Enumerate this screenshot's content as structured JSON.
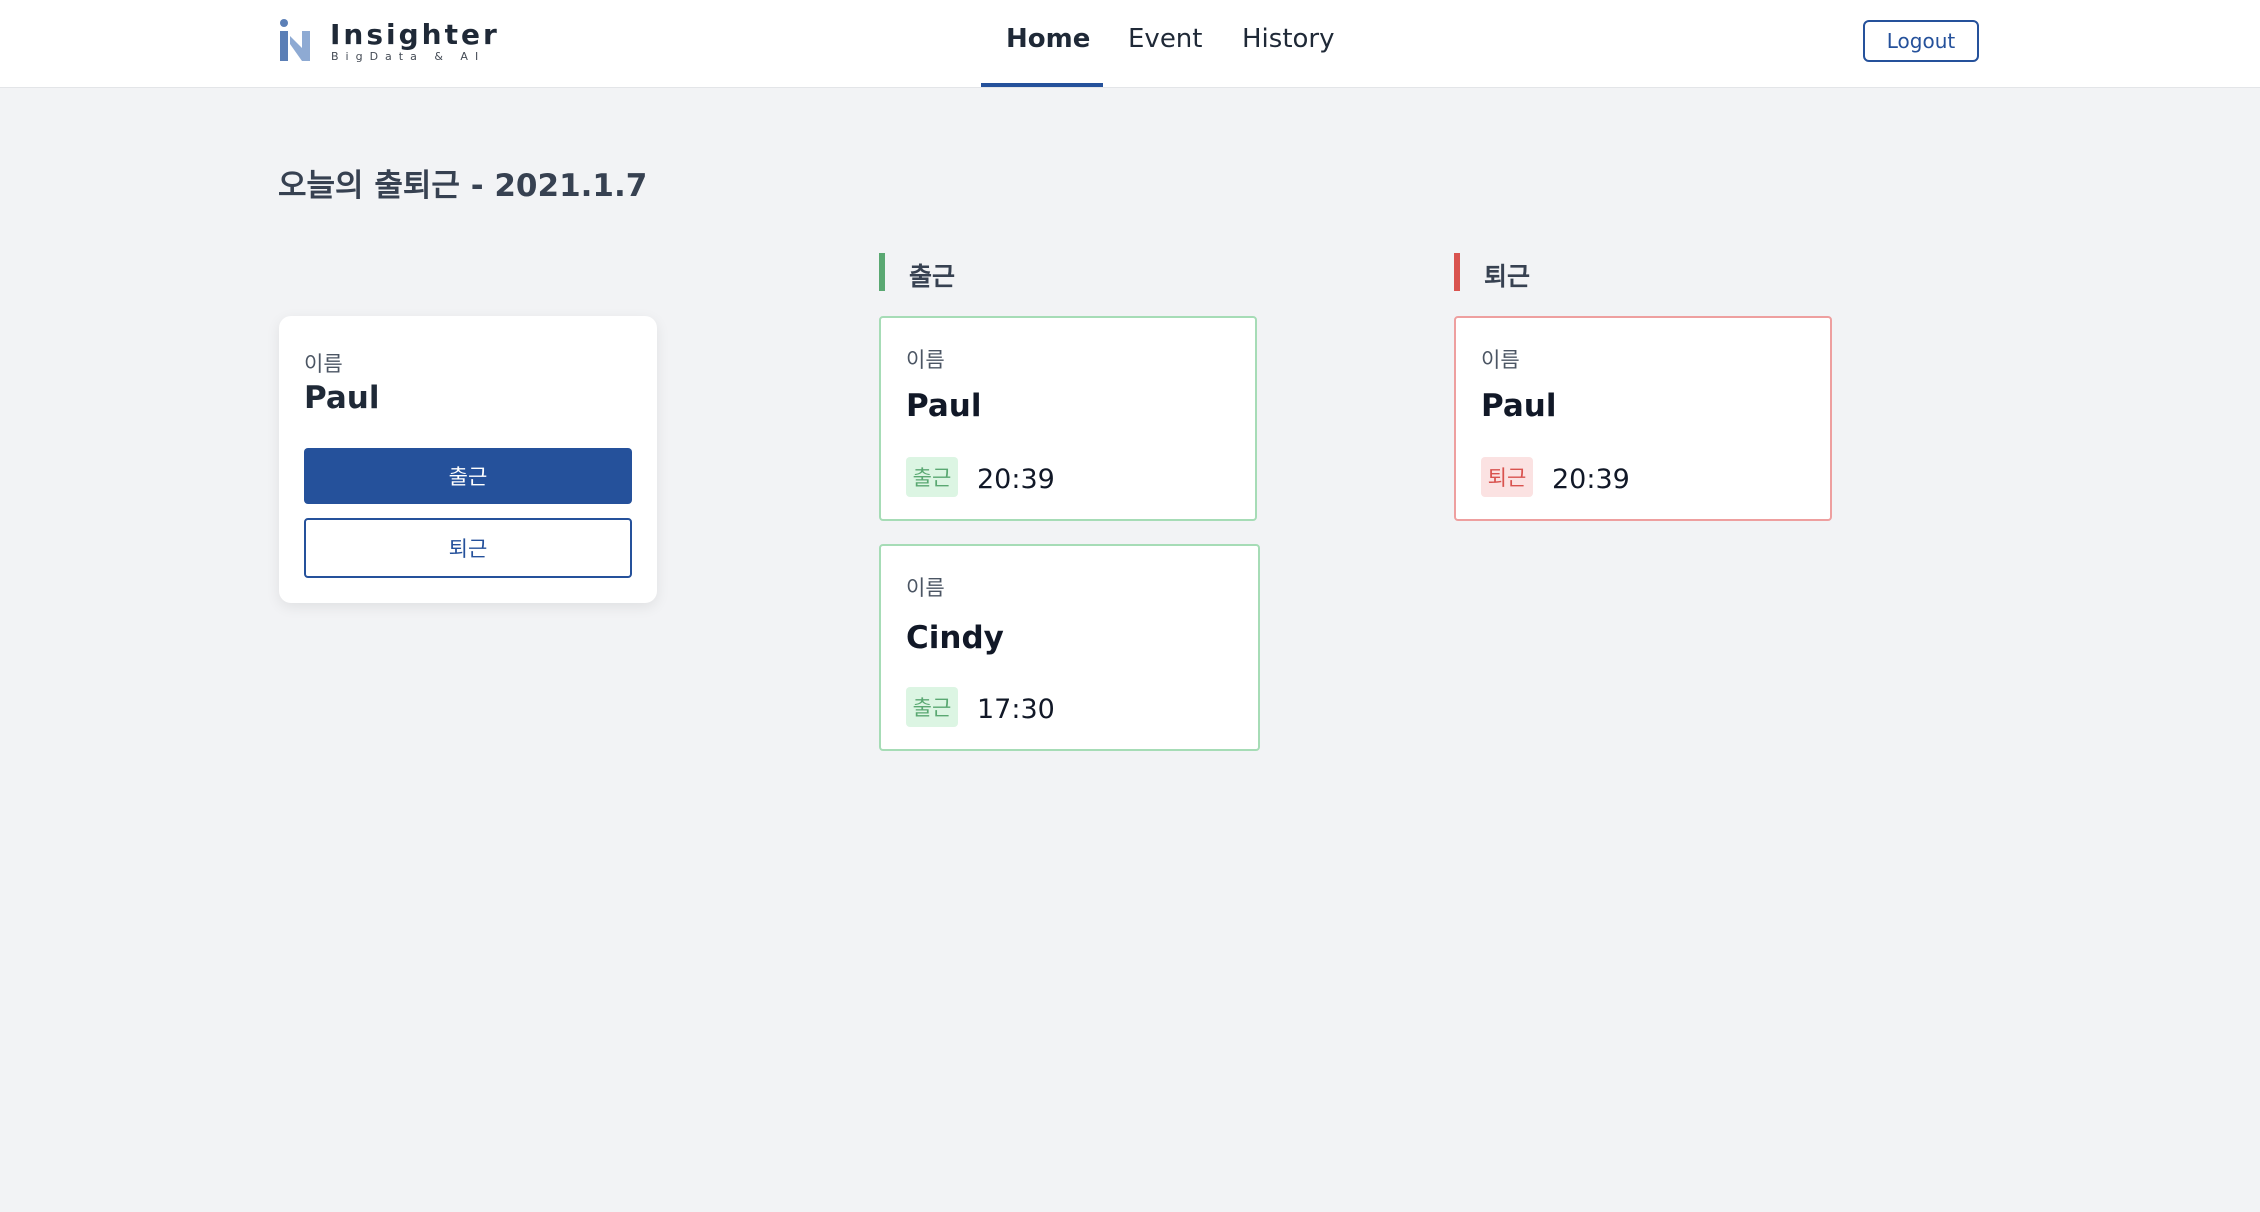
{
  "app": {
    "name": "Insighter",
    "tagline": "BigData & AI"
  },
  "nav": {
    "items": [
      "Home",
      "Event",
      "History"
    ],
    "active": "Home"
  },
  "header": {
    "logout_label": "Logout"
  },
  "page": {
    "title": "오늘의 출퇴근 - 2021.1.7"
  },
  "checkin_panel": {
    "name_label": "이름",
    "name": "Paul",
    "checkin_button": "출근",
    "checkout_button": "퇴근"
  },
  "columns": {
    "checkin": {
      "title": "출근",
      "accent": "#5aa872",
      "records": [
        {
          "name_label": "이름",
          "name": "Paul",
          "tag": "출근",
          "time": "20:39"
        },
        {
          "name_label": "이름",
          "name": "Cindy",
          "tag": "출근",
          "time": "17:30"
        }
      ]
    },
    "checkout": {
      "title": "퇴근",
      "accent": "#d9534f",
      "records": [
        {
          "name_label": "이름",
          "name": "Paul",
          "tag": "퇴근",
          "time": "20:39"
        }
      ]
    }
  },
  "colors": {
    "primary": "#25519b",
    "background": "#f2f3f5"
  }
}
